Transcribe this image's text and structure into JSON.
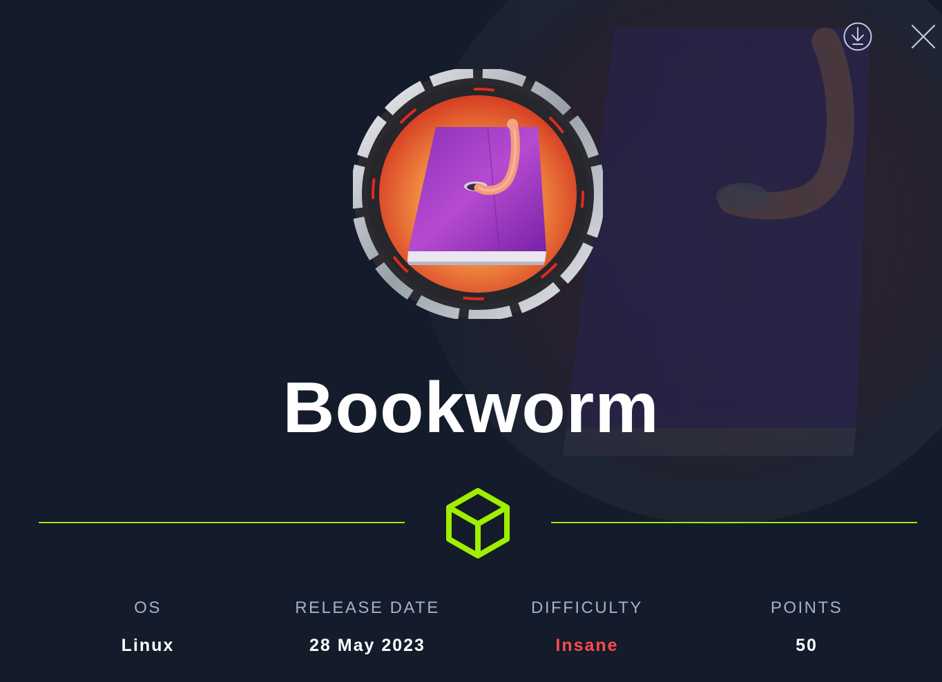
{
  "toolbar": {
    "download_icon": "download-circle-icon",
    "close_icon": "close-x-icon"
  },
  "machine": {
    "name": "Bookworm",
    "avatar_icon": "bookworm-badge"
  },
  "divider": {
    "icon": "cube-icon",
    "color": "#9fef00"
  },
  "stats": {
    "os": {
      "label": "OS",
      "value": "Linux"
    },
    "release_date": {
      "label": "RELEASE DATE",
      "value": "28 May 2023"
    },
    "difficulty": {
      "label": "DIFFICULTY",
      "value": "Insane",
      "color": "#ff4a4a"
    },
    "points": {
      "label": "POINTS",
      "value": "50"
    }
  },
  "colors": {
    "background": "#141b2a",
    "accent": "#9fef00",
    "label": "#a4b1cd"
  }
}
